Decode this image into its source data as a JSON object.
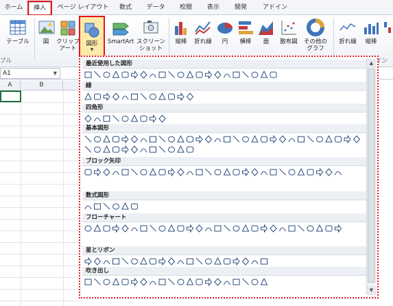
{
  "tabs": [
    {
      "label": "ホーム",
      "active": false
    },
    {
      "label": "挿入",
      "active": true
    },
    {
      "label": "ページ レイアウト",
      "active": false
    },
    {
      "label": "数式",
      "active": false
    },
    {
      "label": "データ",
      "active": false
    },
    {
      "label": "校閲",
      "active": false
    },
    {
      "label": "表示",
      "active": false
    },
    {
      "label": "開発",
      "active": false
    },
    {
      "label": "アドイン",
      "active": false
    }
  ],
  "ribbon": {
    "table_label": "テーブル",
    "picture_label": "図",
    "clipart_line1": "クリップ",
    "clipart_line2": "アート",
    "shapes_label": "図形",
    "smartart_label": "SmartArt",
    "screenshot_line1": "スクリーン",
    "screenshot_line2": "ショット",
    "column_label": "縦棒",
    "line_label": "折れ線",
    "pie_label": "円",
    "bar_label": "横棒",
    "area_label": "面",
    "scatter_label": "散布図",
    "other_line1": "その他の",
    "other_line2": "グラフ",
    "spark_line_label": "折れ線",
    "spark_column_label": "縦棒",
    "group_table_partial": "ブル",
    "group_sparkline_partial": "イン"
  },
  "namebox": {
    "value": "A1"
  },
  "columns": [
    "A",
    "B"
  ],
  "gallery": {
    "categories": [
      {
        "label": "最近使用した図形",
        "count": 21
      },
      {
        "label": "線",
        "count": 12
      },
      {
        "label": "四角形",
        "count": 9
      },
      {
        "label": "基本図形",
        "count": 42
      },
      {
        "label": "ブロック矢印",
        "count": 28
      },
      {
        "label": "数式図形",
        "count": 6
      },
      {
        "label": "フローチャート",
        "count": 28
      },
      {
        "label": "星とリボン",
        "count": 20
      },
      {
        "label": "吹き出し",
        "count": 20
      }
    ]
  },
  "colors": {
    "highlight_red": "#e1161c",
    "selected_button": "#fde9a8",
    "shape_stroke": "#2a4d7e"
  }
}
